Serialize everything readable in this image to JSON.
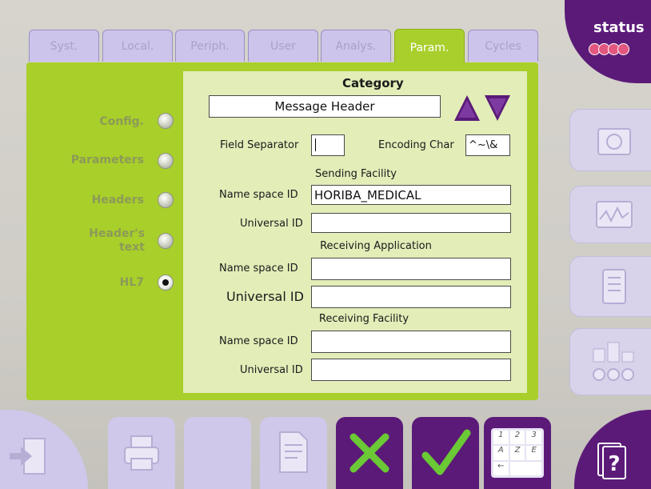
{
  "tabs": [
    {
      "label": "Syst."
    },
    {
      "label": "Local."
    },
    {
      "label": "Periph."
    },
    {
      "label": "User"
    },
    {
      "label": "Analys."
    },
    {
      "label": "Param."
    },
    {
      "label": "Cycles"
    }
  ],
  "active_tab": "Param.",
  "status": {
    "label": "status"
  },
  "menu": [
    {
      "label": "Config.",
      "selected": false
    },
    {
      "label": "Parameters",
      "selected": false
    },
    {
      "label": "Headers",
      "selected": false
    },
    {
      "label": "Header's text",
      "selected": false
    },
    {
      "label": "HL7",
      "selected": true
    }
  ],
  "category": {
    "title": "Category",
    "value": "Message Header"
  },
  "form": {
    "field_separator_label": "Field Separator",
    "field_separator_value": "",
    "encoding_char_label": "Encoding Char",
    "encoding_char_value": "^~\\&",
    "sending_facility": "Sending Facility",
    "receiving_application": "Receiving Application",
    "receiving_facility": "Receiving Facility",
    "name_space_label": "Name space ID",
    "universal_id_label": "Universal ID",
    "sf_name_space": "HORIBA_MEDICAL",
    "sf_universal": "",
    "ra_name_space": "",
    "ra_universal": "",
    "rf_name_space": "",
    "rf_universal": ""
  },
  "keypad": [
    "1",
    "2",
    "3",
    "A",
    "Z",
    "E"
  ],
  "colors": {
    "accent_green": "#a9cf2c",
    "purple": "#5b1a78",
    "lavender": "#cdc4ec"
  }
}
